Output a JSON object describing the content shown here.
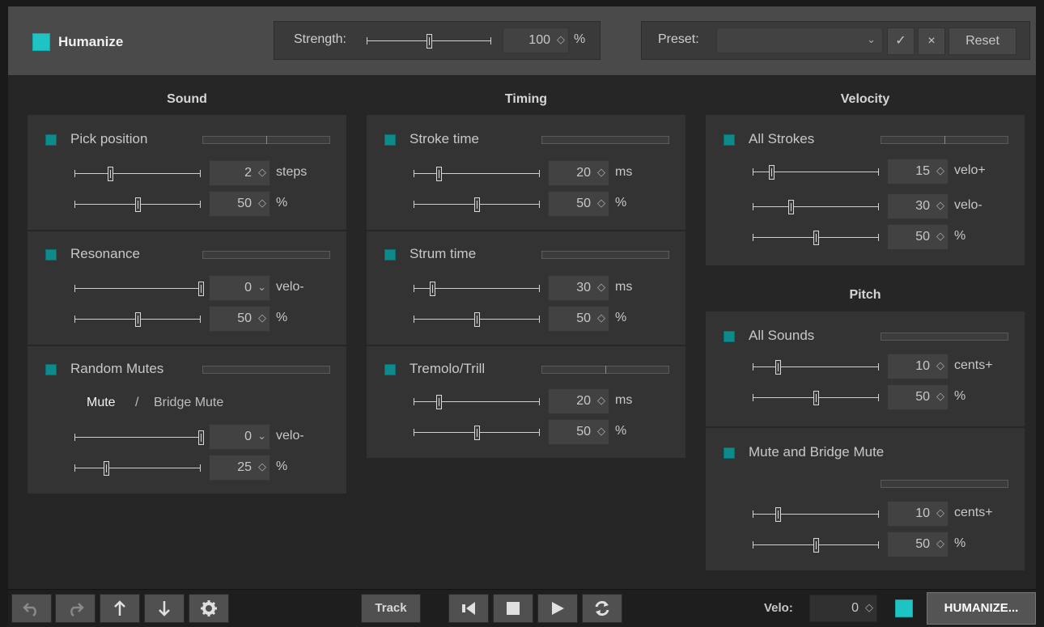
{
  "header": {
    "title": "Humanize",
    "strength": {
      "label": "Strength:",
      "value": "100",
      "unit": "%",
      "level": 0.5
    },
    "preset": {
      "label": "Preset:",
      "value": "",
      "confirm": "✓",
      "clear": "×",
      "reset": "Reset"
    }
  },
  "sound": {
    "title": "Sound",
    "pick_position": {
      "label": "Pick position",
      "meter_marker": 0.5,
      "rows": [
        {
          "value": "2",
          "unit": "steps",
          "level": 0.28
        },
        {
          "value": "50",
          "unit": "%",
          "level": 0.5
        }
      ]
    },
    "resonance": {
      "label": "Resonance",
      "meter_marker": null,
      "rows": [
        {
          "value": "0",
          "unit": "velo-",
          "level": 1.0
        },
        {
          "value": "50",
          "unit": "%",
          "level": 0.5
        }
      ]
    },
    "random_mutes": {
      "label": "Random Mutes",
      "meter_marker": null,
      "mute": "Mute",
      "separator": "/",
      "bridge_mute": "Bridge Mute",
      "rows": [
        {
          "value": "0",
          "unit": "velo-",
          "level": 1.0
        },
        {
          "value": "25",
          "unit": "%",
          "level": 0.25
        }
      ]
    }
  },
  "timing": {
    "title": "Timing",
    "stroke_time": {
      "label": "Stroke time",
      "rows": [
        {
          "value": "20",
          "unit": "ms",
          "level": 0.2
        },
        {
          "value": "50",
          "unit": "%",
          "level": 0.5
        }
      ]
    },
    "strum_time": {
      "label": "Strum time",
      "rows": [
        {
          "value": "30",
          "unit": "ms",
          "level": 0.15
        },
        {
          "value": "50",
          "unit": "%",
          "level": 0.5
        }
      ]
    },
    "tremolo_trill": {
      "label": "Tremolo/Trill",
      "meter_marker": 0.5,
      "rows": [
        {
          "value": "20",
          "unit": "ms",
          "level": 0.2
        },
        {
          "value": "50",
          "unit": "%",
          "level": 0.5
        }
      ]
    }
  },
  "velocity": {
    "title": "Velocity",
    "all_strokes": {
      "label": "All Strokes",
      "meter_marker": 0.5,
      "rows": [
        {
          "value": "15",
          "unit": "velo+",
          "level": 0.15
        },
        {
          "value": "30",
          "unit": "velo-",
          "level": 0.3
        },
        {
          "value": "50",
          "unit": "%",
          "level": 0.5
        }
      ]
    }
  },
  "pitch": {
    "title": "Pitch",
    "all_sounds": {
      "label": "All Sounds",
      "rows": [
        {
          "value": "10",
          "unit": "cents+",
          "level": 0.2
        },
        {
          "value": "50",
          "unit": "%",
          "level": 0.5
        }
      ]
    },
    "mute_bridge": {
      "label": "Mute and Bridge Mute",
      "rows": [
        {
          "value": "10",
          "unit": "cents+",
          "level": 0.2
        },
        {
          "value": "50",
          "unit": "%",
          "level": 0.5
        }
      ]
    }
  },
  "footer": {
    "track": "Track",
    "velo_label": "Velo:",
    "velo_value": "0",
    "humanize_button": "HUMANIZE..."
  },
  "colors": {
    "accent": "#1ec4c4",
    "checkbox": "#0f8a8a",
    "panel": "#333333",
    "header": "#4a4a4a"
  },
  "icons": [
    "undo-icon",
    "redo-icon",
    "arrow-up-icon",
    "arrow-down-icon",
    "gear-icon",
    "rewind-icon",
    "stop-icon",
    "play-icon",
    "loop-icon"
  ]
}
